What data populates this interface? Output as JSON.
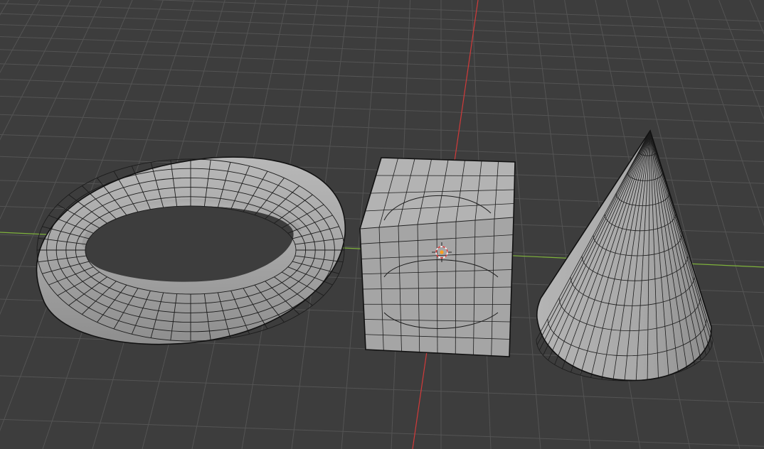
{
  "viewport": {
    "background_color": "#3d3d3d",
    "grid_color": "#545454",
    "x_axis_color": "#7fb33c",
    "y_axis_color": "#d23a3a",
    "mesh_fill_color": "#a9a9a9",
    "mesh_wire_color": "#1c1c1c",
    "origin_color": "#ffa020"
  },
  "objects": [
    {
      "name": "torus",
      "icon": "torus-mesh-icon"
    },
    {
      "name": "cube",
      "icon": "cube-mesh-icon"
    },
    {
      "name": "cone",
      "icon": "cone-mesh-icon"
    }
  ],
  "cursor": {
    "icon": "3d-cursor-icon"
  }
}
